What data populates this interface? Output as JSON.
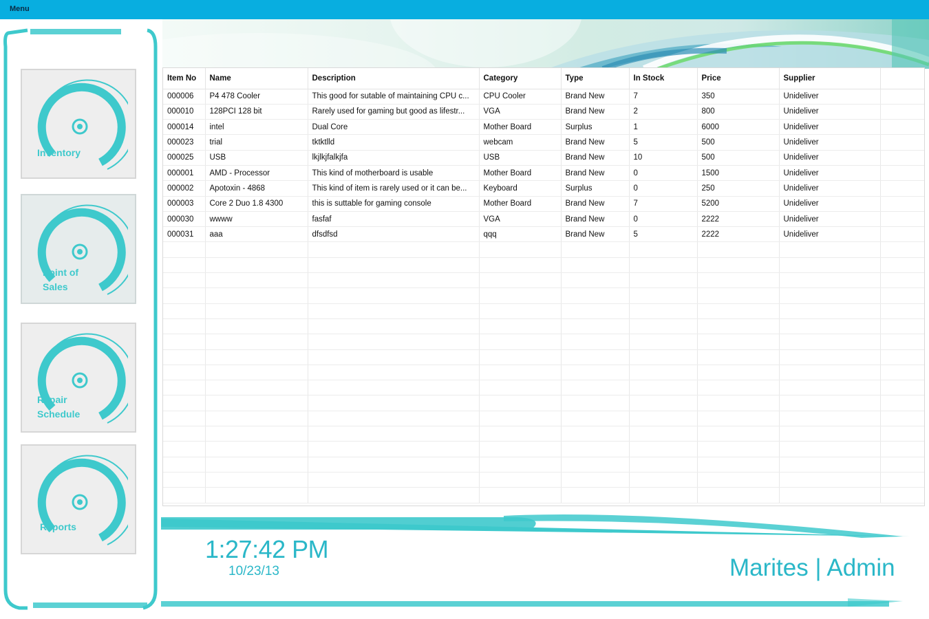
{
  "menubar": {
    "menu_label": "Menu"
  },
  "sidebar": {
    "tiles": [
      {
        "label": "Inventory"
      },
      {
        "label": "Point of\nSales"
      },
      {
        "label": "Repair\nSchedule"
      },
      {
        "label": "Reports"
      }
    ]
  },
  "table": {
    "columns": [
      "Item No",
      "Name",
      "Description",
      "Category",
      "Type",
      "In Stock",
      "Price",
      "Supplier"
    ],
    "rows": [
      [
        "000006",
        "P4 478 Cooler",
        "This good for sutable of maintaining CPU c...",
        "CPU Cooler",
        "Brand New",
        "7",
        "350",
        "Unideliver"
      ],
      [
        "000010",
        "128PCI 128 bit",
        "Rarely used for gaming but good as lifestr...",
        "VGA",
        "Brand New",
        "2",
        "800",
        "Unideliver"
      ],
      [
        "000014",
        "intel",
        "Dual Core",
        "Mother Board",
        "Surplus",
        "1",
        "6000",
        "Unideliver"
      ],
      [
        "000023",
        "trial",
        "tktktlld",
        "webcam",
        "Brand New",
        "5",
        "500",
        "Unideliver"
      ],
      [
        "000025",
        "USB",
        "lkjlkjfalkjfa",
        "USB",
        "Brand New",
        "10",
        "500",
        "Unideliver"
      ],
      [
        "000001",
        "AMD - Processor",
        "This kind of motherboard is usable",
        "Mother Board",
        "Brand New",
        "0",
        "1500",
        "Unideliver"
      ],
      [
        "000002",
        "Apotoxin - 4868",
        "This kind of item is rarely used or it can be...",
        "Keyboard",
        "Surplus",
        "0",
        "250",
        "Unideliver"
      ],
      [
        "000003",
        "Core 2 Duo 1.8 4300",
        "this is suttable for gaming console",
        "Mother Board",
        "Brand New",
        "7",
        "5200",
        "Unideliver"
      ],
      [
        "000030",
        "wwww",
        "fasfaf",
        "VGA",
        "Brand New",
        "0",
        "2222",
        "Unideliver"
      ],
      [
        "000031",
        "aaa",
        "dfsdfsd",
        "qqq",
        "Brand New",
        "5",
        "2222",
        "Unideliver"
      ]
    ]
  },
  "footer": {
    "time": "1:27:42 PM",
    "date": "10/23/13",
    "user": "Marites | Admin"
  },
  "colors": {
    "accent": "#3ec9cc",
    "menubar": "#08aee0",
    "text_accent": "#2ab7c8"
  }
}
